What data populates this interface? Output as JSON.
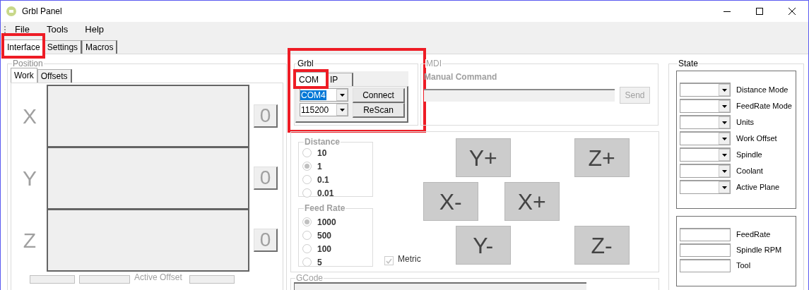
{
  "window": {
    "title": "Grbl Panel"
  },
  "menu": [
    "File",
    "Tools",
    "Help"
  ],
  "tabs": [
    {
      "label": "Interface",
      "selected": true,
      "highlighted": true
    },
    {
      "label": "Settings",
      "selected": false,
      "highlighted": false
    },
    {
      "label": "Macros",
      "selected": false,
      "highlighted": false
    }
  ],
  "position": {
    "title": "Position",
    "tabs": [
      {
        "label": "Work",
        "selected": true
      },
      {
        "label": "Offsets",
        "selected": false
      }
    ],
    "axes": [
      {
        "label": "X",
        "zero_button": "0"
      },
      {
        "label": "Y",
        "zero_button": "0"
      },
      {
        "label": "Z",
        "zero_button": "0"
      }
    ],
    "active_offset_label": "Active Offset"
  },
  "grbl": {
    "title": "Grbl",
    "highlighted": true,
    "tabs": [
      {
        "label": "COM",
        "selected": true,
        "highlighted": true
      },
      {
        "label": "IP",
        "selected": false,
        "highlighted": false
      }
    ],
    "port": "COM4",
    "baud": "115200",
    "buttons": [
      "Connect",
      "ReScan"
    ]
  },
  "mdi": {
    "title": "MDI",
    "label": "Manual Command",
    "send": "Send",
    "disabled": true
  },
  "jogging": {
    "distance": {
      "title": "Distance",
      "options": [
        {
          "label": "10",
          "selected": false
        },
        {
          "label": "1",
          "selected": true
        },
        {
          "label": "0.1",
          "selected": false
        },
        {
          "label": "0.01",
          "selected": false
        }
      ]
    },
    "feed_rate": {
      "title": "Feed Rate",
      "options": [
        {
          "label": "1000",
          "selected": true
        },
        {
          "label": "500",
          "selected": false
        },
        {
          "label": "100",
          "selected": false
        },
        {
          "label": "5",
          "selected": false
        }
      ]
    },
    "metric": {
      "label": "Metric",
      "checked": true
    },
    "buttons": [
      [
        "Y+",
        "Z+"
      ],
      [
        "X-",
        "X+"
      ],
      [
        "Y-",
        "Z-"
      ]
    ]
  },
  "gcode": {
    "title": "GCode"
  },
  "state": {
    "title": "State",
    "modes": [
      "Distance Mode",
      "FeedRate Mode",
      "Units",
      "Work Offset",
      "Spindle",
      "Coolant",
      "Active Plane"
    ],
    "readouts": [
      "FeedRate",
      "Spindle RPM",
      "Tool"
    ]
  }
}
